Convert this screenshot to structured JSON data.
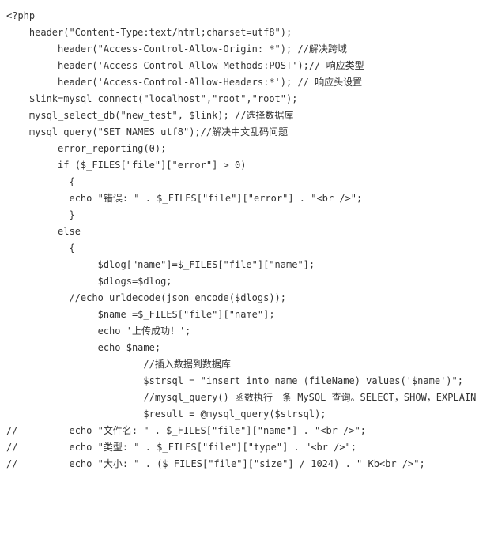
{
  "lines": [
    "<?php",
    "    header(\"Content-Type:text/html;charset=utf8\");",
    "         header(\"Access-Control-Allow-Origin: *\"); //解决跨域",
    "         header('Access-Control-Allow-Methods:POST');// 响应类型",
    "         header('Access-Control-Allow-Headers:*'); // 响应头设置",
    "    $link=mysql_connect(\"localhost\",\"root\",\"root\");",
    "    mysql_select_db(\"new_test\", $link); //选择数据库",
    "    mysql_query(\"SET NAMES utf8\");//解决中文乱码问题",
    "         error_reporting(0);",
    "         if ($_FILES[\"file\"][\"error\"] > 0)",
    "           {",
    "           echo \"错误: \" . $_FILES[\"file\"][\"error\"] . \"<br />\";",
    "           }",
    "         else",
    "           {",
    "                $dlog[\"name\"]=$_FILES[\"file\"][\"name\"];",
    "                $dlogs=$dlog;",
    "           //echo urldecode(json_encode($dlogs));",
    "                $name =$_FILES[\"file\"][\"name\"];",
    "                echo '上传成功！';",
    "                echo $name;",
    "                        //插入数据到数据库",
    "                        $strsql = \"insert into name (fileName) values('$name')\";",
    "                        //mysql_query() 函数执行一条 MySQL 查询。SELECT，SHOW，EXPLAIN",
    "                        $result = @mysql_query($strsql);",
    "//         echo \"文件名: \" . $_FILES[\"file\"][\"name\"] . \"<br />\";",
    "//         echo \"类型: \" . $_FILES[\"file\"][\"type\"] . \"<br />\";",
    "//         echo \"大小: \" . ($_FILES[\"file\"][\"size\"] / 1024) . \" Kb<br />\";"
  ]
}
